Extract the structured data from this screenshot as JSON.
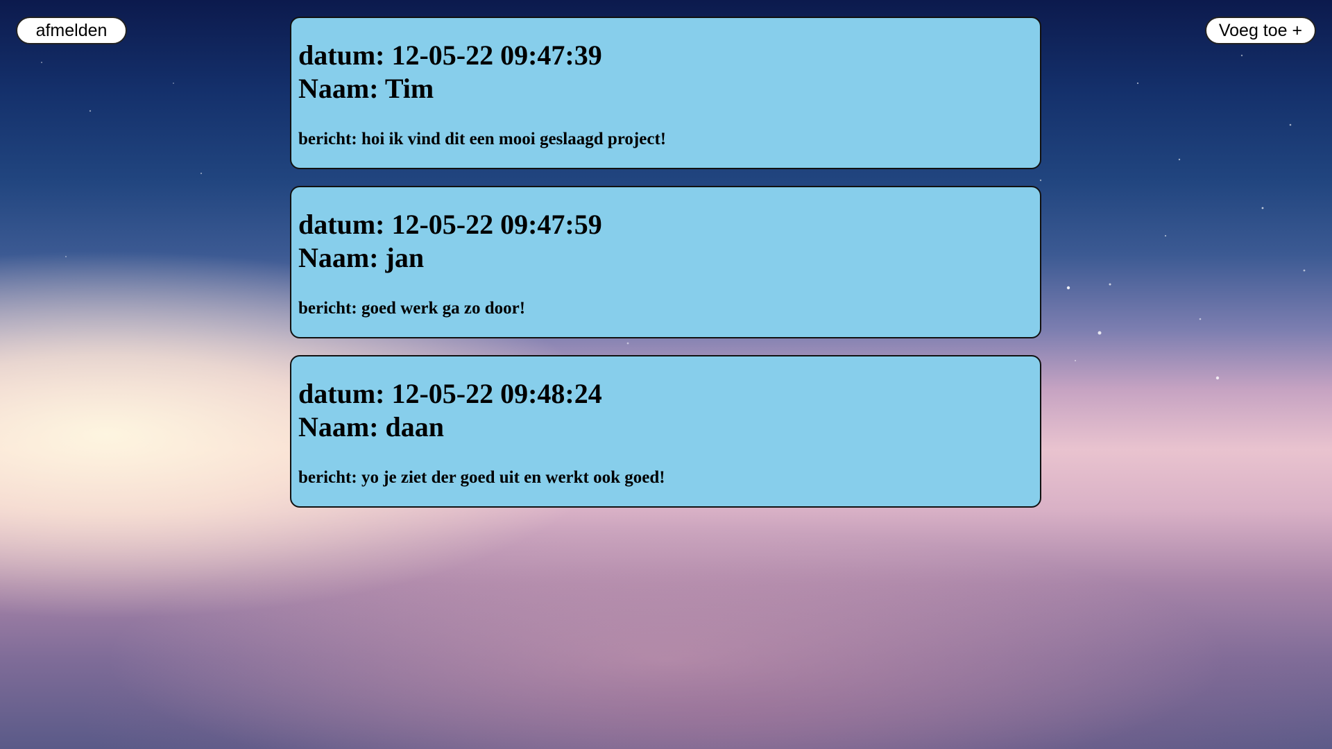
{
  "header": {
    "logout_label": "afmelden",
    "add_label": "Voeg toe +"
  },
  "labels": {
    "datum": "datum:",
    "naam": "Naam:",
    "bericht": "bericht:"
  },
  "messages": [
    {
      "datum": "12-05-22 09:47:39",
      "naam": "Tim",
      "bericht": "hoi ik vind dit een mooi geslaagd project!"
    },
    {
      "datum": "12-05-22 09:47:59",
      "naam": "jan",
      "bericht": "goed werk ga zo door!"
    },
    {
      "datum": "12-05-22 09:48:24",
      "naam": "daan",
      "bericht": "yo je ziet der goed uit en werkt ook goed!"
    }
  ],
  "colors": {
    "card_background": "#87ceeb",
    "button_background": "#ffffff"
  }
}
